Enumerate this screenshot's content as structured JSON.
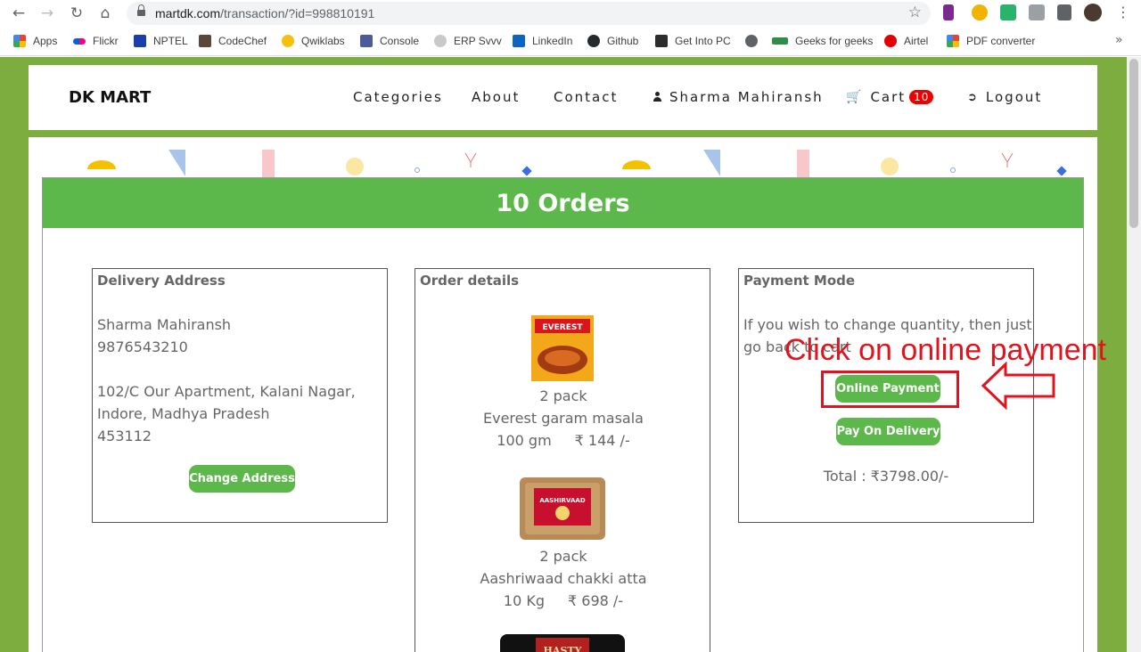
{
  "browser": {
    "url_host": "martdk.com",
    "url_path": "/transaction/?id=998810191",
    "bookmarks": [
      "Apps",
      "Flickr",
      "NPTEL",
      "CodeChef",
      "Qwiklabs",
      "Console",
      "ERP Svvv",
      "LinkedIn",
      "Github",
      "Get Into PC",
      "",
      "Geeks for geeks",
      "Airtel",
      "PDF converter"
    ]
  },
  "navbar": {
    "brand": "DK MART",
    "categories": "Categories",
    "about": "About",
    "contact": "Contact",
    "user": "Sharma Mahiransh",
    "cart": "Cart",
    "cart_count": "10",
    "logout": "Logout"
  },
  "orders": {
    "title": "10 Orders"
  },
  "delivery": {
    "title": "Delivery Address",
    "name": "Sharma Mahiransh",
    "phone": "9876543210",
    "address_line1": "102/C Our Apartment, Kalani Nagar,",
    "address_line2": "Indore, Madhya Pradesh",
    "pincode": "453112",
    "change_button": "Change Address"
  },
  "order_details": {
    "title": "Order details",
    "items": [
      {
        "qty": "2 pack",
        "name": "Everest garam masala",
        "weight": "100 gm",
        "price": "₹ 144 /-"
      },
      {
        "qty": "2 pack",
        "name": "Aashriwaad chakki atta",
        "weight": "10 Kg",
        "price": "₹ 698 /-"
      }
    ]
  },
  "payment": {
    "title": "Payment Mode",
    "note_line1": "If you wish to change quantity, then just",
    "note_line2": "go back to cart",
    "online_button": "Online Payment",
    "cod_button": "Pay On Delivery",
    "total": "Total : ₹3798.00/-"
  },
  "annotation": {
    "text": "Click on online payment",
    "color": "#e1141e"
  },
  "colors": {
    "page_bg": "#7cad3e",
    "accent_green": "#5cb84a",
    "cart_badge": "#ee0000"
  }
}
